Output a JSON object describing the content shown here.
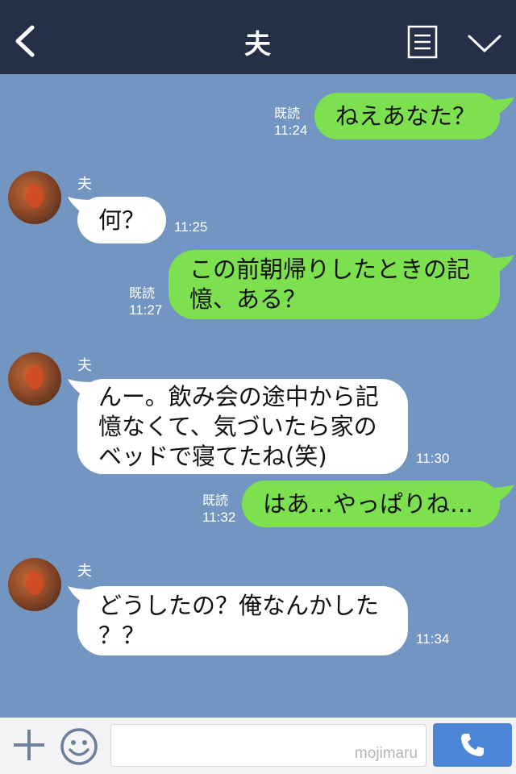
{
  "header": {
    "title": "夫"
  },
  "messages": [
    {
      "from": "me",
      "text": "ねえあなた？",
      "read": "既読",
      "time": "11:24"
    },
    {
      "from": "them",
      "sender": "夫",
      "text": "何？",
      "time": "11:25"
    },
    {
      "from": "me",
      "line1": "この前朝帰りしたときの記",
      "line2": "憶、ある？",
      "read": "既読",
      "time": "11:27"
    },
    {
      "from": "them",
      "sender": "夫",
      "line1": "んー。飲み会の途中から記",
      "line2": "憶なくて、気づいたら家の",
      "line3": "ベッドで寝てたね(笑)",
      "time": "11:30"
    },
    {
      "from": "me",
      "text": "はあ…やっぱりね…",
      "read": "既読",
      "time": "11:32"
    },
    {
      "from": "them",
      "sender": "夫",
      "line1": "どうしたの？俺なんかした",
      "line2": "？？",
      "time": "11:34"
    }
  ],
  "input": {
    "watermark": "mojimaru"
  },
  "icons": {
    "back": "chevron-left-icon",
    "menu": "menu-list-icon",
    "dropdown": "chevron-down-icon",
    "plus": "plus-icon",
    "emoji": "emoji-icon",
    "call": "phone-icon"
  },
  "colors": {
    "header": "#252f47",
    "background": "#7395c2",
    "my_bubble": "#7de04e",
    "their_bubble": "#ffffff",
    "call_button": "#4b86d8"
  }
}
